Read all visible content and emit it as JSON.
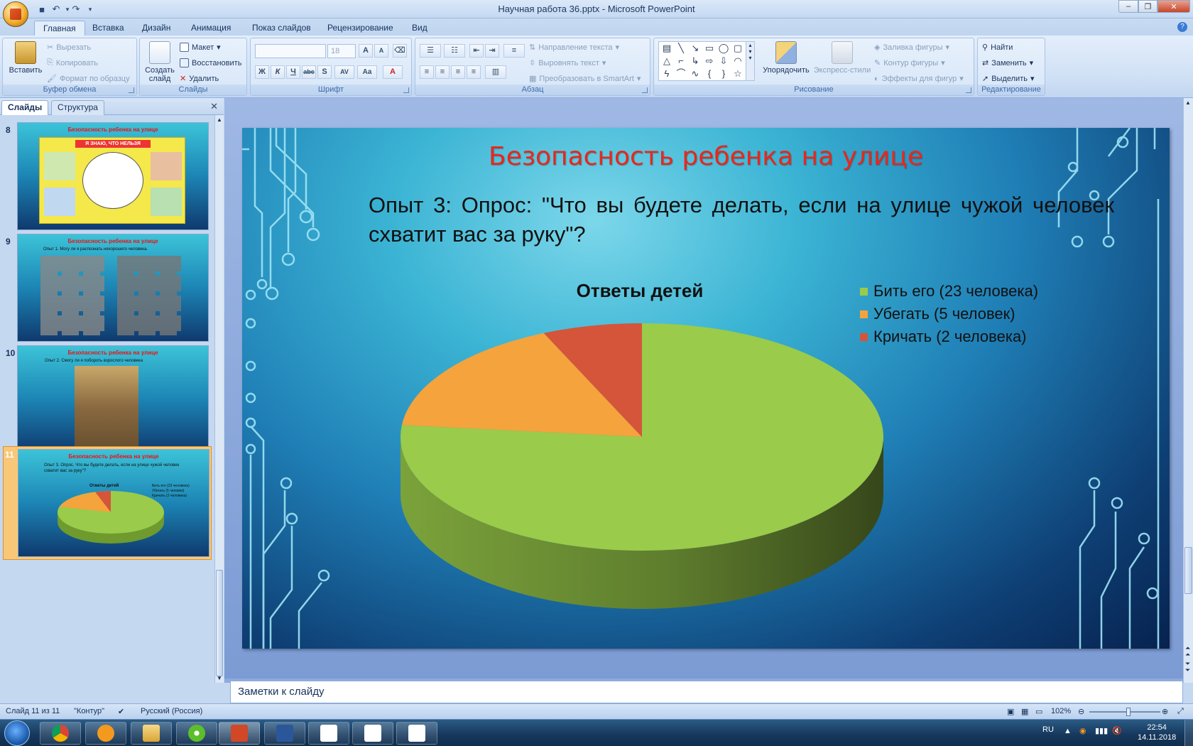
{
  "window": {
    "title": "Научная работа 36.pptx - Microsoft PowerPoint",
    "tabs": [
      "Главная",
      "Вставка",
      "Дизайн",
      "Анимация",
      "Показ слайдов",
      "Рецензирование",
      "Вид"
    ]
  },
  "ribbon": {
    "clipboard": {
      "label": "Буфер обмена",
      "paste": "Вставить",
      "cut": "Вырезать",
      "copy": "Копировать",
      "format_painter": "Формат по образцу"
    },
    "slides": {
      "label": "Слайды",
      "new_slide": "Создать слайд",
      "layout": "Макет",
      "reset": "Восстановить",
      "delete": "Удалить"
    },
    "font": {
      "label": "Шрифт",
      "size": "18"
    },
    "paragraph": {
      "label": "Абзац",
      "text_direction": "Направление текста",
      "align_text": "Выровнять текст",
      "convert_smartart": "Преобразовать в SmartArt"
    },
    "drawing": {
      "label": "Рисование",
      "arrange": "Упорядочить",
      "quick_styles": "Экспресс-стили",
      "shape_fill": "Заливка фигуры",
      "shape_outline": "Контур фигуры",
      "shape_effects": "Эффекты для фигур"
    },
    "editing": {
      "label": "Редактирование",
      "find": "Найти",
      "replace": "Заменить",
      "select": "Выделить"
    }
  },
  "panel": {
    "tab_slides": "Слайды",
    "tab_outline": "Структура",
    "thumbnails": [
      {
        "num": "8",
        "title": "Безопасность ребенка на улице",
        "caption": "Я ЗНАЮ, ЧТО НЕЛЬЗЯ"
      },
      {
        "num": "9",
        "title": "Безопасность ребенка на улице",
        "caption": "Опыт 1. Могу ли я распознать нехорошего человека."
      },
      {
        "num": "10",
        "title": "Безопасность ребенка на улице",
        "caption": "Опыт 2. Смогу ли я побороть взрослого человека"
      },
      {
        "num": "11",
        "title": "Безопасность ребенка на улице",
        "caption": "Опыт 3. Опрос. Что вы будете делать, если на улице чужой человек схватит вас за руку\"?",
        "chart_title": "Ответы детей"
      }
    ]
  },
  "slide": {
    "title": "Безопасность ребенка на улице",
    "body": "Опыт 3: Опрос: \"Что вы будете делать, если на улице чужой человек схватит вас за руку\"?"
  },
  "chart_data": {
    "type": "pie",
    "title": "Ответы детей",
    "categories": [
      "Бить его (23 человека)",
      "Убегать (5 человек)",
      "Кричать (2 человека)"
    ],
    "values": [
      23,
      5,
      2
    ],
    "colors": [
      "#9acb4a",
      "#f5a33c",
      "#d4553a"
    ],
    "legend": "top-right",
    "style": "3d"
  },
  "notes": {
    "placeholder": "Заметки к слайду"
  },
  "status": {
    "slide": "Слайд 11 из 11",
    "theme": "\"Контур\"",
    "language": "Русский (Россия)",
    "zoom": "102%"
  },
  "taskbar": {
    "lang": "RU",
    "time": "22:54",
    "date": "14.11.2018"
  }
}
